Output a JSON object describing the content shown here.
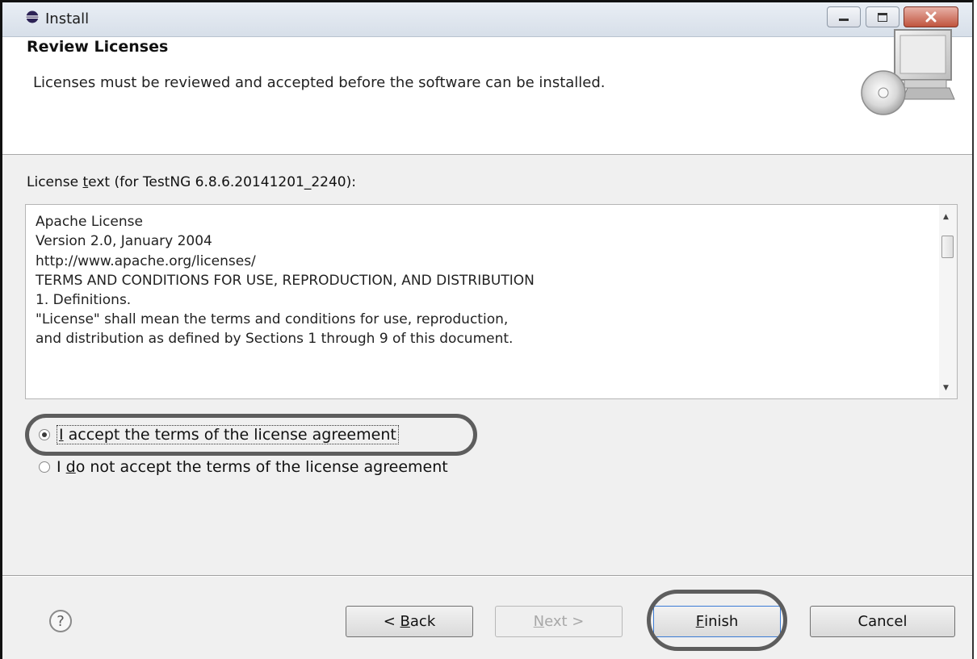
{
  "window": {
    "title": "Install",
    "controls": [
      "minimize",
      "maximize",
      "close"
    ]
  },
  "header": {
    "title": "Review Licenses",
    "subtitle": "Licenses must be reviewed and accepted before the software can be installed."
  },
  "license": {
    "label_prefix": "License ",
    "label_mnemonic": "t",
    "label_rest": "ext (for TestNG 6.8.6.20141201_2240):",
    "lines": [
      "Apache License",
      "Version 2.0, January 2004",
      "http://www.apache.org/licenses/",
      "TERMS AND CONDITIONS FOR USE, REPRODUCTION, AND DISTRIBUTION",
      "1. Definitions.",
      "\"License\" shall mean the terms and conditions for use, reproduction,",
      "and distribution as defined by Sections 1 through 9 of this document."
    ]
  },
  "options": {
    "accept": {
      "mnemonic": "I",
      "rest": " accept the terms of the license agreement",
      "checked": true
    },
    "decline": {
      "prefix": "I ",
      "mnemonic": "d",
      "rest": "o not accept the terms of the license agreement",
      "checked": false
    }
  },
  "buttons": {
    "help": "?",
    "back_prefix": "< ",
    "back_mnemonic": "B",
    "back_rest": "ack",
    "next_mnemonic": "N",
    "next_rest": "ext >",
    "next_enabled": false,
    "finish_mnemonic": "F",
    "finish_rest": "inish",
    "cancel": "Cancel"
  },
  "icons": {
    "app": "eclipse-icon",
    "banner": "install-computer-cd-icon",
    "help": "help-icon"
  }
}
